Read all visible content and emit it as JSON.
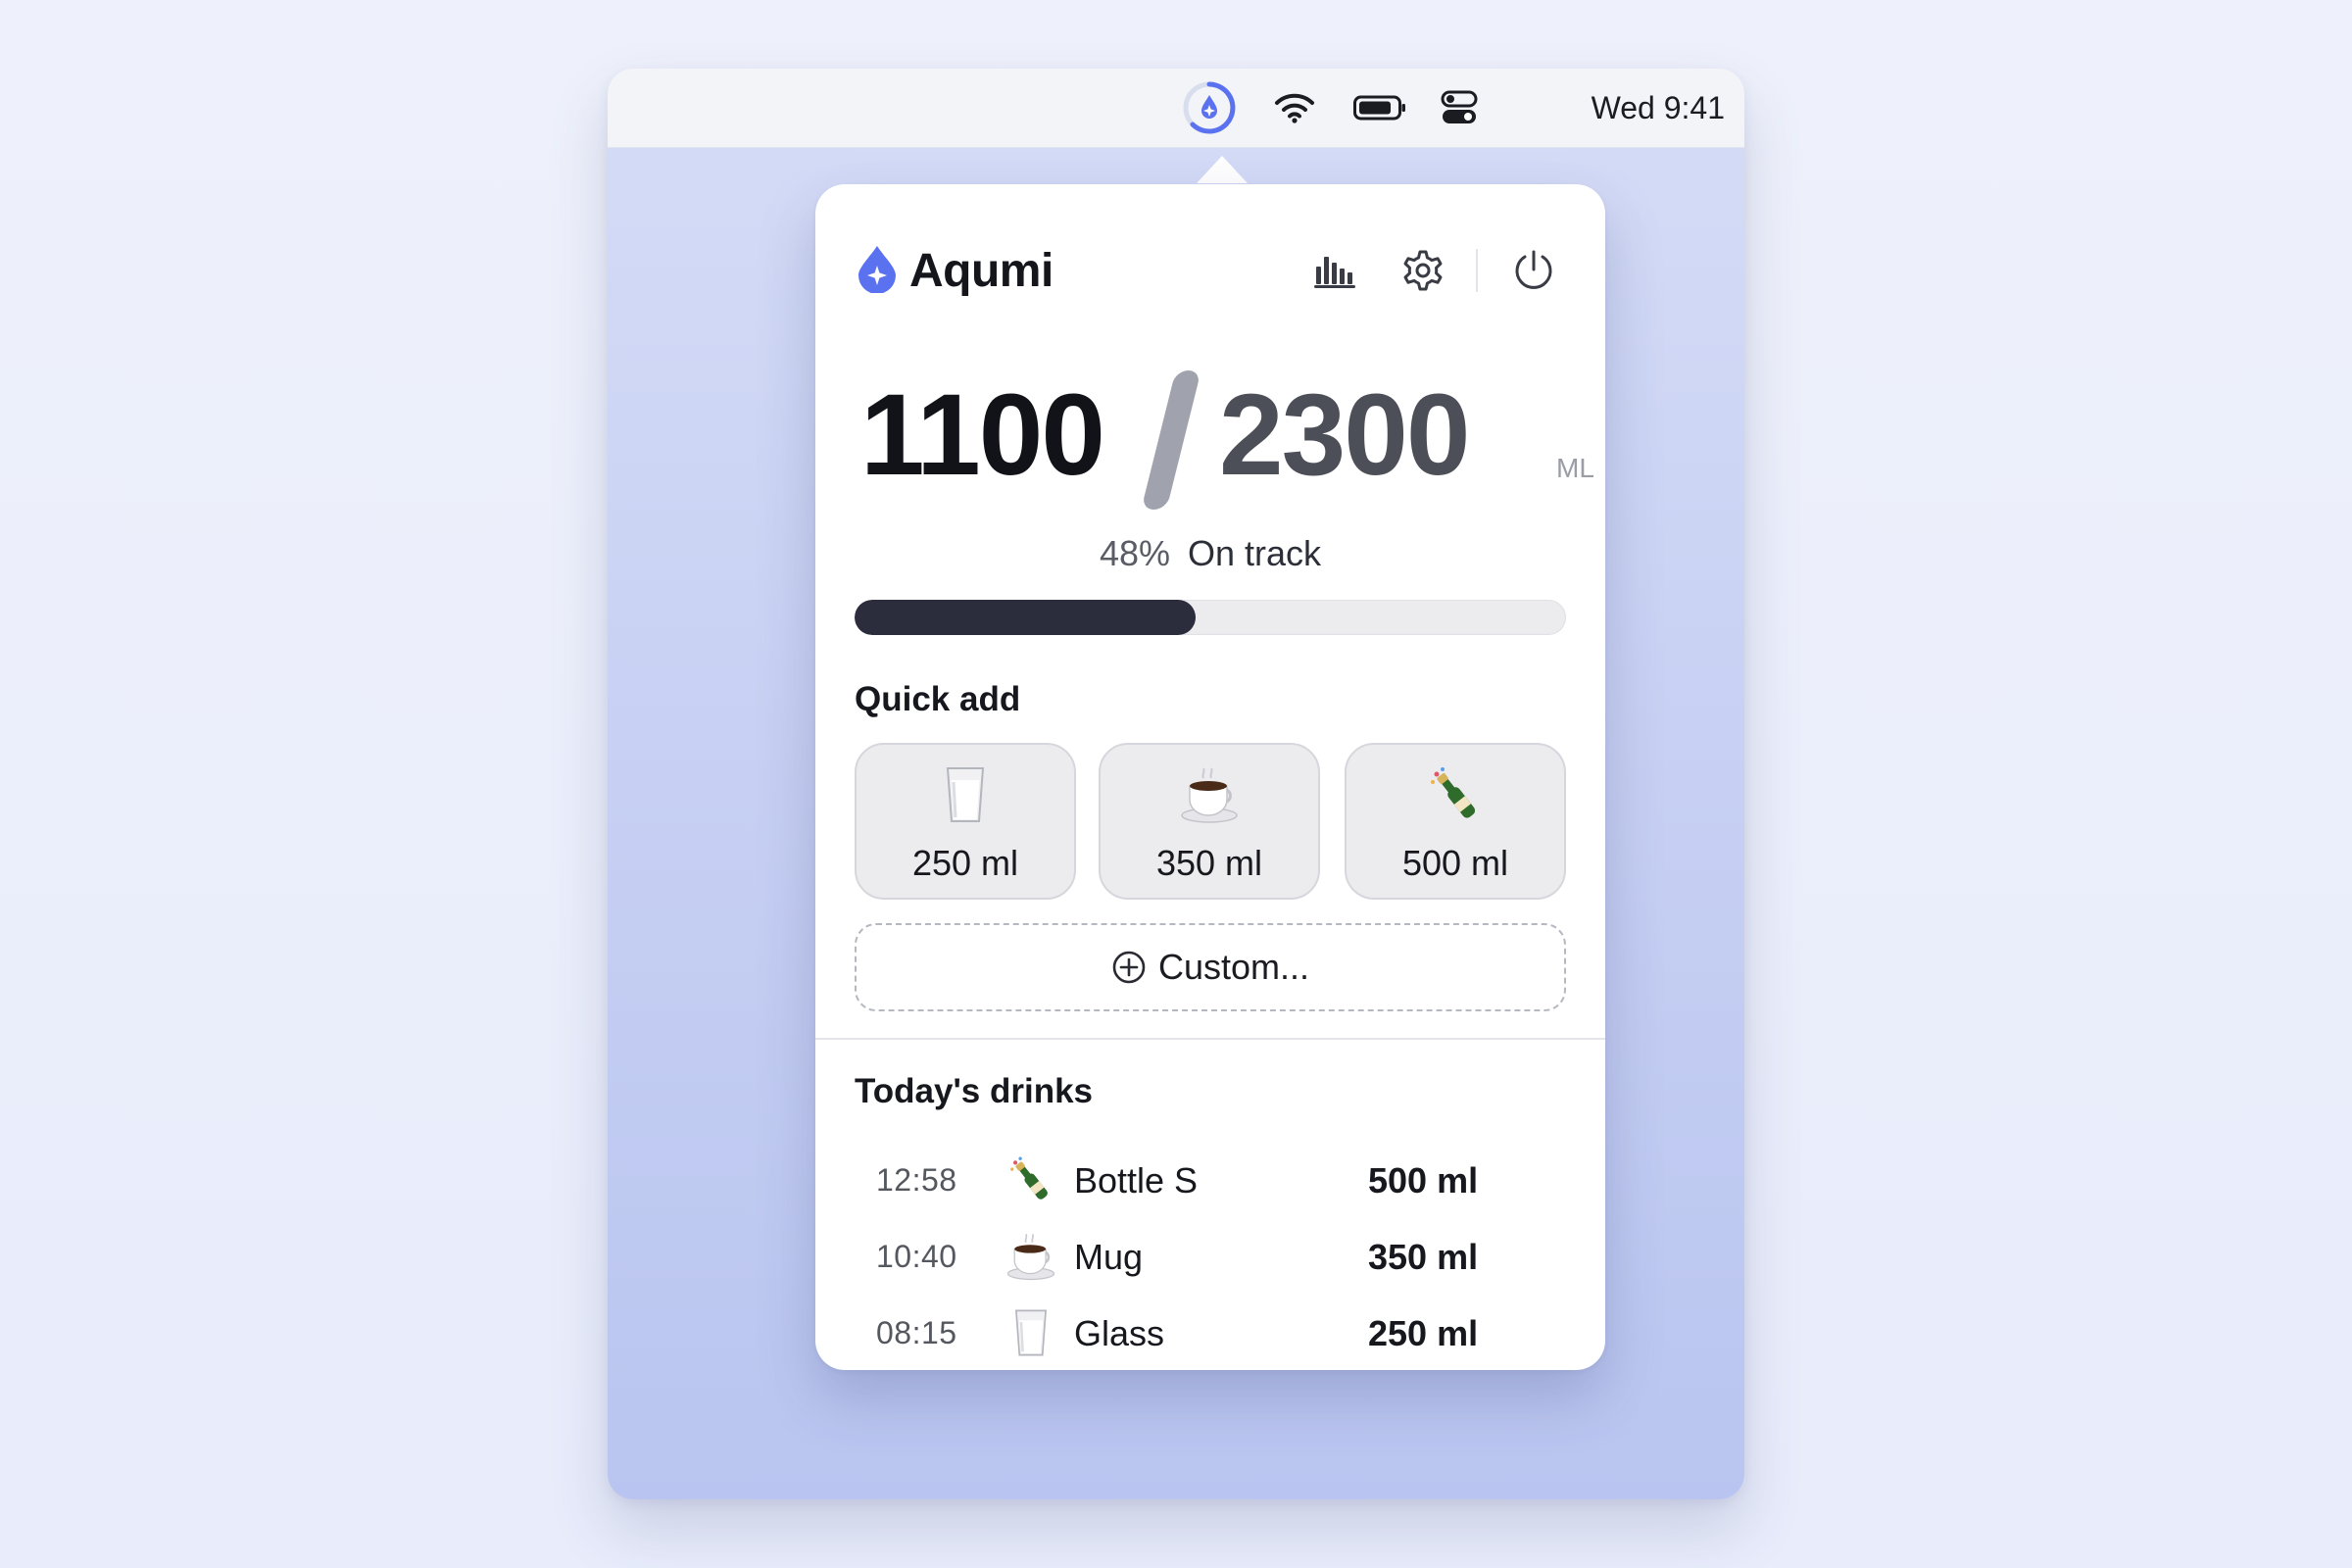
{
  "menubar": {
    "app_icon": "water-drop-ring-icon",
    "icons": [
      "wifi-icon",
      "battery-icon",
      "control-center-icon"
    ],
    "clock": "Wed 9:41"
  },
  "popover": {
    "app_name": "Aqumi",
    "header_buttons": [
      "stats-icon",
      "gear-icon",
      "power-icon"
    ],
    "intake": {
      "current": "1100",
      "goal": "2300",
      "unit": "ML",
      "percent_label": "48%",
      "status": "On track",
      "progress": 0.48
    },
    "quick_add": {
      "title": "Quick add",
      "items": [
        {
          "label": "250 ml",
          "icon": "glass-icon"
        },
        {
          "label": "350 ml",
          "icon": "mug-icon"
        },
        {
          "label": "500 ml",
          "icon": "bottle-icon"
        }
      ],
      "custom_label": "Custom..."
    },
    "todays_drinks": {
      "title": "Today's drinks",
      "rows": [
        {
          "time": "12:58",
          "icon": "bottle-icon",
          "name": "Bottle S",
          "amount": "500 ml"
        },
        {
          "time": "10:40",
          "icon": "mug-icon",
          "name": "Mug",
          "amount": "350 ml"
        },
        {
          "time": "08:15",
          "icon": "glass-icon",
          "name": "Glass",
          "amount": "250 ml"
        }
      ]
    }
  },
  "colors": {
    "accent": "#5b72f0",
    "progress_fill": "#2b2c3c",
    "progress_track": "#ececef"
  }
}
